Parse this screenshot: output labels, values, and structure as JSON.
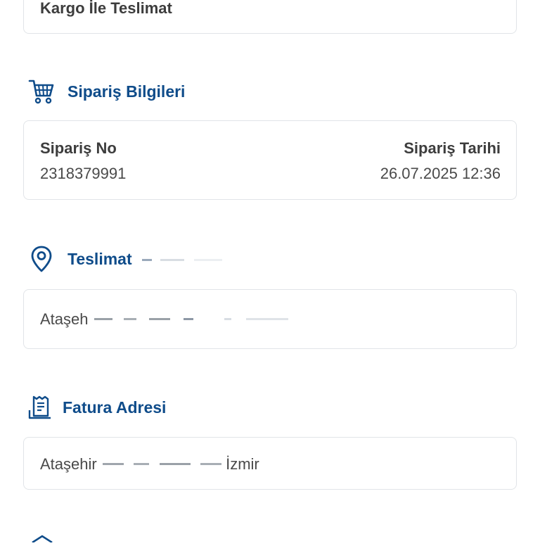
{
  "delivery_method": {
    "value": "Kargo İle Teslimat"
  },
  "order_info": {
    "title": "Sipariş Bilgileri",
    "icon": "cart-icon",
    "order_no_label": "Sipariş No",
    "order_no_value": "2318379991",
    "order_date_label": "Sipariş Tarihi",
    "order_date_value": "26.07.2025 12:36"
  },
  "delivery_address": {
    "title": "Teslimat",
    "icon": "location-pin-icon",
    "value": "Ataşeh"
  },
  "billing_address": {
    "title": "Fatura Adresi",
    "icon": "receipt-icon",
    "value": "Ataşehir",
    "value_suffix": "İzmir"
  },
  "colors": {
    "accent": "#0f4c8a",
    "border": "#e1e4e8",
    "text": "#3d3d3d"
  }
}
